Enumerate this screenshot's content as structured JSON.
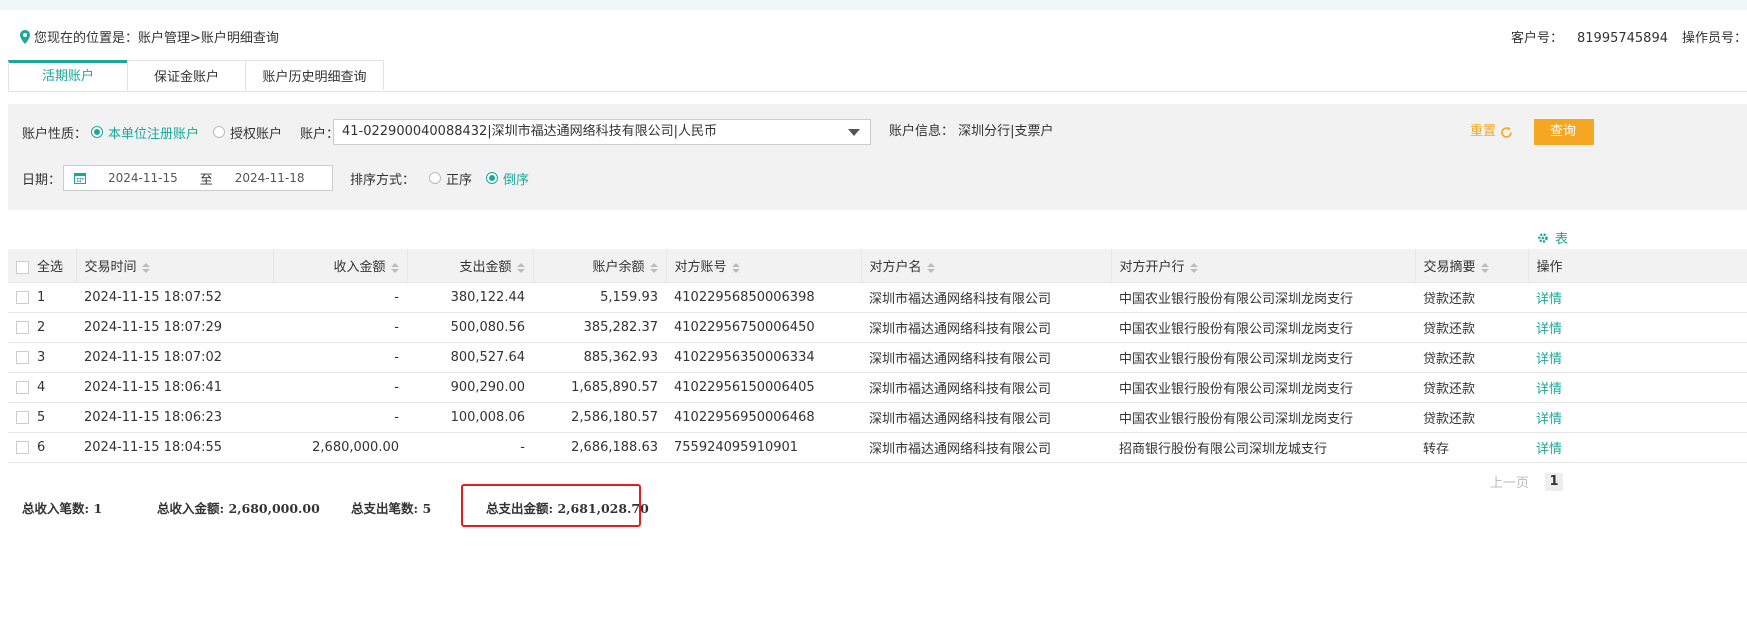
{
  "breadcrumb": "您现在的位置是：账户管理>账户明细查询",
  "customer": {
    "label": "客户号：",
    "value": "81995745894",
    "operator_label": "操作员号："
  },
  "tabs": [
    {
      "label": "活期账户",
      "active": true
    },
    {
      "label": "保证金账户",
      "active": false
    },
    {
      "label": "账户历史明细查询",
      "active": false
    }
  ],
  "filter": {
    "nature_label": "账户性质：",
    "nature_options": [
      "本单位注册账户",
      "授权账户"
    ],
    "account_label": "账户：",
    "account_value": "41-022900040088432|深圳市福达通网络科技有限公司|人民币",
    "info_label": "账户信息：",
    "info_value": "深圳分行|支票户",
    "reset_label": "重置",
    "query_label": "查询",
    "date_label": "日期：",
    "date_from": "2024-11-15",
    "date_sep": "至",
    "date_to": "2024-11-18",
    "sort_label": "排序方式：",
    "sort_options": [
      "正序",
      "倒序"
    ]
  },
  "settings_label": "表",
  "table": {
    "headers": [
      "全选",
      "交易时间",
      "收入金额",
      "支出金额",
      "账户余额",
      "对方账号",
      "对方户名",
      "对方开户行",
      "交易摘要",
      "操作"
    ],
    "rows": [
      [
        "1",
        "2024-11-15 18:07:52",
        "-",
        "380,122.44",
        "5,159.93",
        "41022956850006398",
        "深圳市福达通网络科技有限公司",
        "中国农业银行股份有限公司深圳龙岗支行",
        "贷款还款",
        "详情"
      ],
      [
        "2",
        "2024-11-15 18:07:29",
        "-",
        "500,080.56",
        "385,282.37",
        "41022956750006450",
        "深圳市福达通网络科技有限公司",
        "中国农业银行股份有限公司深圳龙岗支行",
        "贷款还款",
        "详情"
      ],
      [
        "3",
        "2024-11-15 18:07:02",
        "-",
        "800,527.64",
        "885,362.93",
        "41022956350006334",
        "深圳市福达通网络科技有限公司",
        "中国农业银行股份有限公司深圳龙岗支行",
        "贷款还款",
        "详情"
      ],
      [
        "4",
        "2024-11-15 18:06:41",
        "-",
        "900,290.00",
        "1,685,890.57",
        "41022956150006405",
        "深圳市福达通网络科技有限公司",
        "中国农业银行股份有限公司深圳龙岗支行",
        "贷款还款",
        "详情"
      ],
      [
        "5",
        "2024-11-15 18:06:23",
        "-",
        "100,008.06",
        "2,586,180.57",
        "41022956950006468",
        "深圳市福达通网络科技有限公司",
        "中国农业银行股份有限公司深圳龙岗支行",
        "贷款还款",
        "详情"
      ],
      [
        "6",
        "2024-11-15 18:04:55",
        "2,680,000.00",
        "-",
        "2,686,188.63",
        "755924095910901",
        "深圳市福达通网络科技有限公司",
        "招商银行股份有限公司深圳龙城支行",
        "转存",
        "详情"
      ]
    ]
  },
  "pager": {
    "prev": "上一页",
    "current": "1"
  },
  "summary": {
    "income_count": "总收入笔数: 1",
    "income_amount": "总收入金额: 2,680,000.00",
    "expense_count": "总支出笔数: 5",
    "expense_amount": "总支出金额: 2,681,028.70"
  },
  "colors": {
    "accent": "#1aa89b",
    "orange": "#f5a623",
    "highlight": "#e02020"
  }
}
